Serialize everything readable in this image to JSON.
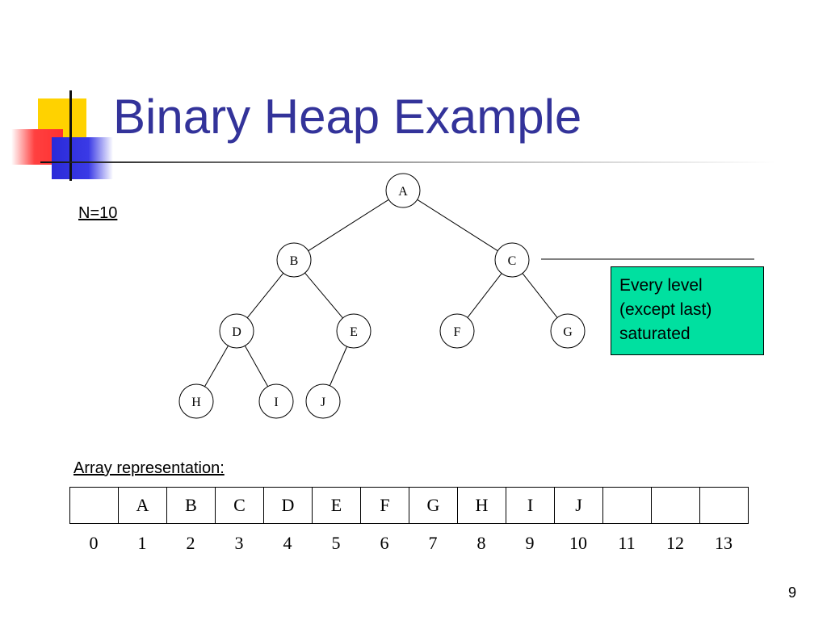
{
  "slide": {
    "title": "Binary Heap Example",
    "n_label": "N=10",
    "array_label": "Array representation:",
    "page_number": "9"
  },
  "callout": {
    "lines": [
      "Every level",
      "(except last)",
      "saturated"
    ],
    "color": "#00e0a0"
  },
  "tree": {
    "nodes": [
      "A",
      "B",
      "C",
      "D",
      "E",
      "F",
      "G",
      "H",
      "I",
      "J"
    ],
    "edges": [
      [
        "A",
        "B"
      ],
      [
        "A",
        "C"
      ],
      [
        "B",
        "D"
      ],
      [
        "B",
        "E"
      ],
      [
        "C",
        "F"
      ],
      [
        "C",
        "G"
      ],
      [
        "D",
        "H"
      ],
      [
        "D",
        "I"
      ],
      [
        "E",
        "J"
      ]
    ]
  },
  "array": {
    "cells": [
      "",
      "A",
      "B",
      "C",
      "D",
      "E",
      "F",
      "G",
      "H",
      "I",
      "J",
      "",
      "",
      ""
    ],
    "indices": [
      "0",
      "1",
      "2",
      "3",
      "4",
      "5",
      "6",
      "7",
      "8",
      "9",
      "10",
      "11",
      "12",
      "13"
    ]
  },
  "colors": {
    "title": "#33339a",
    "accent_yellow": "#ffd200",
    "accent_red": "#ff3030",
    "accent_blue": "#2a2ad8"
  }
}
